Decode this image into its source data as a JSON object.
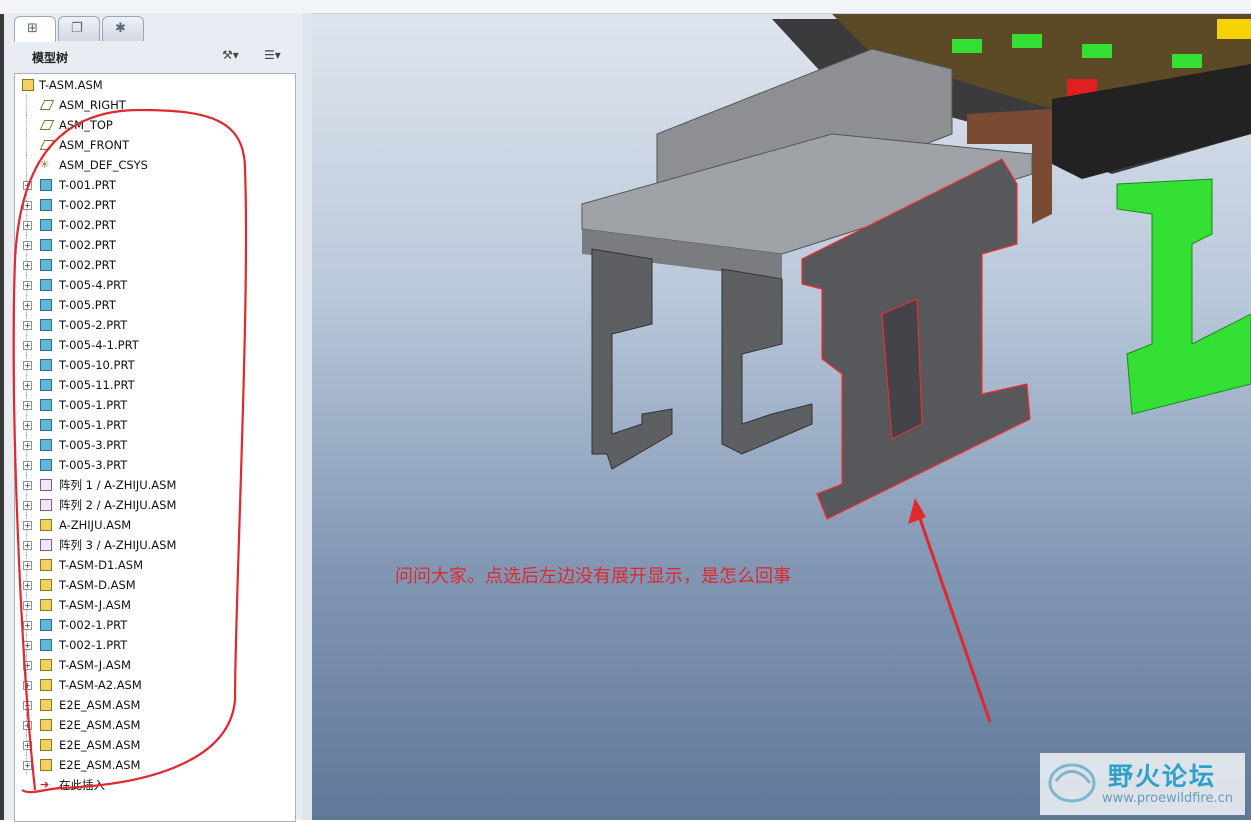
{
  "tabs": [
    {
      "icon": "model-tree-tab-icon"
    },
    {
      "icon": "layers-tab-icon"
    },
    {
      "icon": "favorites-tab-icon"
    }
  ],
  "tree_header": {
    "title": "模型树",
    "settings_icon": "tree-settings-icon",
    "columns_icon": "tree-columns-icon"
  },
  "tree_root": "T-ASM.ASM",
  "tree_items": [
    {
      "label": "ASM_RIGHT",
      "type": "datum"
    },
    {
      "label": "ASM_TOP",
      "type": "datum"
    },
    {
      "label": "ASM_FRONT",
      "type": "datum"
    },
    {
      "label": "ASM_DEF_CSYS",
      "type": "csys"
    },
    {
      "label": "T-001.PRT",
      "type": "prt"
    },
    {
      "label": "T-002.PRT",
      "type": "prt"
    },
    {
      "label": "T-002.PRT",
      "type": "prt"
    },
    {
      "label": "T-002.PRT",
      "type": "prt"
    },
    {
      "label": "T-002.PRT",
      "type": "prt"
    },
    {
      "label": "T-005-4.PRT",
      "type": "prt"
    },
    {
      "label": "T-005.PRT",
      "type": "prt"
    },
    {
      "label": "T-005-2.PRT",
      "type": "prt"
    },
    {
      "label": "T-005-4-1.PRT",
      "type": "prt"
    },
    {
      "label": "T-005-10.PRT",
      "type": "prt"
    },
    {
      "label": "T-005-11.PRT",
      "type": "prt"
    },
    {
      "label": "T-005-1.PRT",
      "type": "prt"
    },
    {
      "label": "T-005-1.PRT",
      "type": "prt"
    },
    {
      "label": "T-005-3.PRT",
      "type": "prt"
    },
    {
      "label": "T-005-3.PRT",
      "type": "prt"
    },
    {
      "label": "阵列 1 / A-ZHIJU.ASM",
      "type": "pattern"
    },
    {
      "label": "阵列 2 / A-ZHIJU.ASM",
      "type": "pattern"
    },
    {
      "label": "A-ZHIJU.ASM",
      "type": "asm"
    },
    {
      "label": "阵列 3 / A-ZHIJU.ASM",
      "type": "pattern"
    },
    {
      "label": "T-ASM-D1.ASM",
      "type": "asm"
    },
    {
      "label": "T-ASM-D.ASM",
      "type": "asm"
    },
    {
      "label": "T-ASM-J.ASM",
      "type": "asm"
    },
    {
      "label": "T-002-1.PRT",
      "type": "prt"
    },
    {
      "label": "T-002-1.PRT",
      "type": "prt"
    },
    {
      "label": "T-ASM-J.ASM",
      "type": "asm"
    },
    {
      "label": "T-ASM-A2.ASM",
      "type": "asm"
    },
    {
      "label": "E2E_ASM.ASM",
      "type": "asm"
    },
    {
      "label": "E2E_ASM.ASM",
      "type": "asm"
    },
    {
      "label": "E2E_ASM.ASM",
      "type": "asm"
    },
    {
      "label": "E2E_ASM.ASM",
      "type": "asm"
    }
  ],
  "insert_here": "在此插入",
  "annotation": {
    "text": "问问大家。点选后左边没有展开显示，是怎么回事",
    "color": "#e0282f"
  },
  "watermark": {
    "title": "野火论坛",
    "url": "www.proewildfire.cn"
  },
  "colors": {
    "annotation_red": "#e0282f",
    "selection_red": "#ff2a2a",
    "green_part": "#33e033",
    "gray_part": "#6a6a6e"
  }
}
